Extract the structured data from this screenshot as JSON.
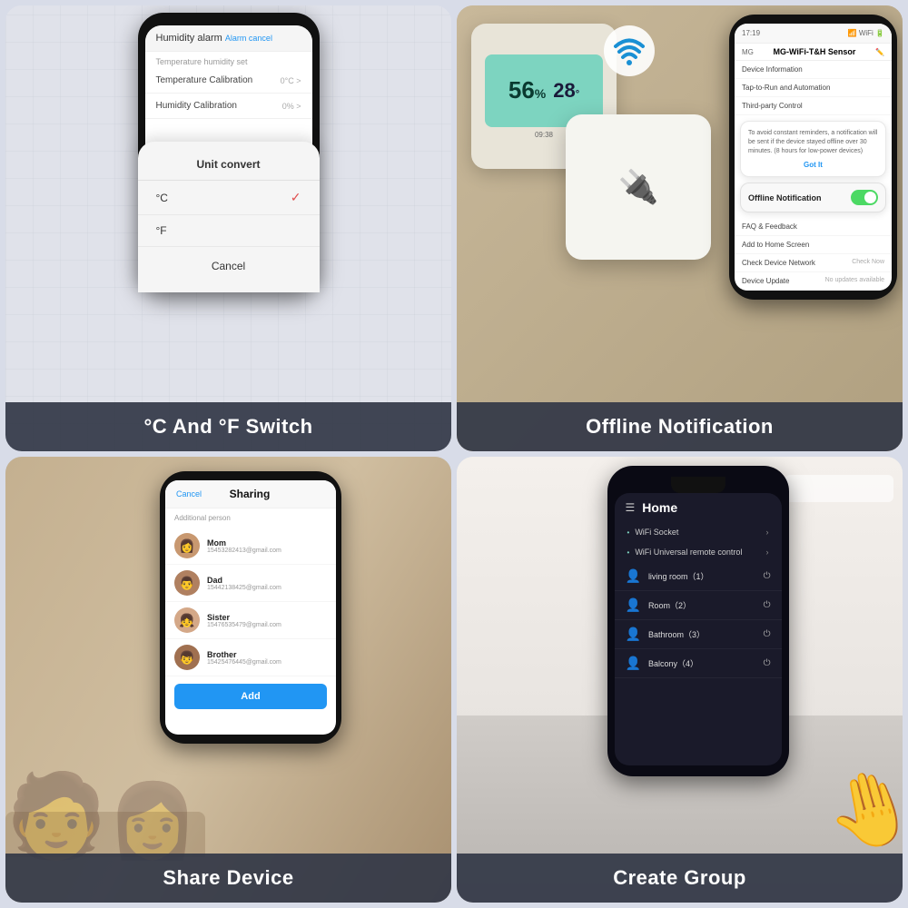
{
  "cells": [
    {
      "id": "cell1",
      "label": "°C And °F Switch",
      "phone": {
        "header": "Humidity alarm",
        "header_right": "Alarm cancel",
        "section": "Temperature humidity set",
        "rows": [
          {
            "label": "Temperature Calibration",
            "value": "0°C >"
          },
          {
            "label": "Humidity Calibration",
            "value": "0% >"
          }
        ],
        "modal_title": "Unit convert",
        "options": [
          {
            "label": "°C",
            "selected": true
          },
          {
            "label": "°F",
            "selected": false
          }
        ],
        "cancel": "Cancel"
      }
    },
    {
      "id": "cell2",
      "label": "Offline Notification",
      "phone": {
        "time": "17:19",
        "device_name": "MG-WiFi-T&H Sensor",
        "menu_items": [
          "Device Information",
          "Tap-to-Run and Automation",
          "Third-party Control"
        ],
        "offline_overlay_text": "To avoid constant reminders, a notification will be sent if the device stayed offline over 30 minutes. (8 hours for low-power devices)",
        "got_it": "Got It",
        "offline_label": "Offline Notification",
        "more_items": [
          {
            "label": "FAQ & Feedback",
            "value": ""
          },
          {
            "label": "Add to Home Screen",
            "value": ""
          },
          {
            "label": "Check Device Network",
            "value": "Check Now"
          },
          {
            "label": "Device Update",
            "value": "No updates available"
          }
        ]
      }
    },
    {
      "id": "cell3",
      "label": "Share Device",
      "sharing": {
        "cancel": "Cancel",
        "title": "Sharing",
        "section": "Additional person",
        "persons": [
          {
            "name": "Mom",
            "email": "15453282413@gmail.com",
            "emoji": "👩"
          },
          {
            "name": "Dad",
            "email": "15442138425@gmail.com",
            "emoji": "👨"
          },
          {
            "name": "Sister",
            "email": "15476535479@gmail.com",
            "emoji": "👧"
          },
          {
            "name": "Brother",
            "email": "15425476445@gmail.com",
            "emoji": "👦"
          }
        ],
        "add_btn": "Add"
      }
    },
    {
      "id": "cell4",
      "label": "Create Group",
      "home": {
        "title": "Home",
        "menu_items": [
          {
            "label": "WiFi Socket",
            "arrow": true
          },
          {
            "label": "WiFi  Universal remote control",
            "arrow": true
          }
        ],
        "rooms": [
          {
            "name": "living room（1）"
          },
          {
            "name": "Room（2）"
          },
          {
            "name": "Bathroom（3）"
          },
          {
            "name": "Balcony（4）"
          }
        ]
      }
    }
  ]
}
